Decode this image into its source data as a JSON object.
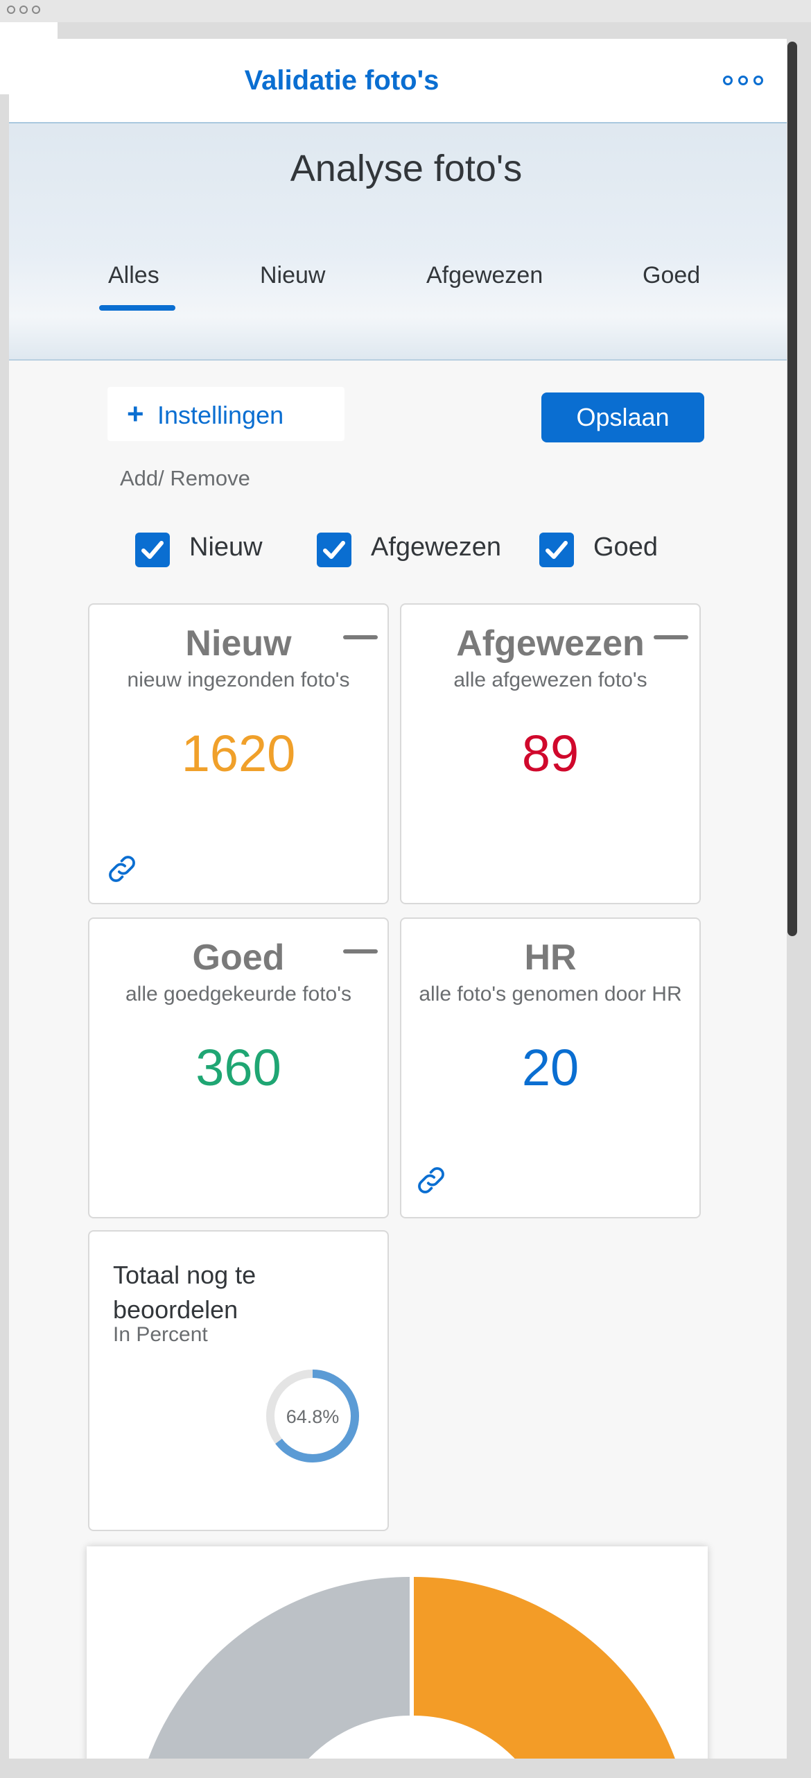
{
  "header": {
    "title": "Validatie foto's"
  },
  "page": {
    "title": "Analyse foto's"
  },
  "tabs": [
    {
      "label": "Alles",
      "selected": true
    },
    {
      "label": "Nieuw",
      "selected": false
    },
    {
      "label": "Afgewezen",
      "selected": false
    },
    {
      "label": "Goed",
      "selected": false
    }
  ],
  "actions": {
    "settings_label": "Instellingen",
    "save_label": "Opslaan",
    "add_remove_label": "Add/ Remove"
  },
  "filters": [
    {
      "label": "Nieuw",
      "checked": true
    },
    {
      "label": "Afgewezen",
      "checked": true
    },
    {
      "label": "Goed",
      "checked": true
    }
  ],
  "tiles": [
    {
      "title": "Nieuw",
      "subtitle": "nieuw ingezonden foto's",
      "value": "1620",
      "color": "#f0a02a"
    },
    {
      "title": "Afgewezen",
      "subtitle": "alle afgewezen foto's",
      "value": "89",
      "color": "#d0082c"
    },
    {
      "title": "Goed",
      "subtitle": "alle goedgekeurde foto's",
      "value": "360",
      "color": "#1fa673"
    },
    {
      "title": "HR",
      "subtitle": "alle foto's genomen door HR",
      "value": "20",
      "color": "#0a6ed1"
    }
  ],
  "percent_tile": {
    "title": "Totaal nog te beoordelen",
    "subtitle": "In Percent",
    "value_label": "64.8%",
    "value": 64.8,
    "color": "#5b9bd5",
    "track_color": "#e4e4e4"
  },
  "colors": {
    "accent": "#0a6ed1"
  }
}
